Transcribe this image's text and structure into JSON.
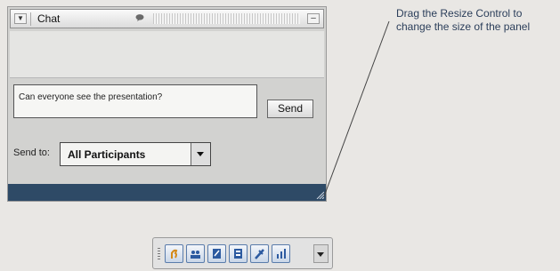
{
  "panel": {
    "title": "Chat",
    "message_text": "Can everyone see the presentation?",
    "send_label": "Send",
    "send_to_label": "Send to:",
    "send_to_value": "All Participants"
  },
  "callout": {
    "line1": "Drag the Resize Control to",
    "line2": "change the size of the panel"
  },
  "colors": {
    "status_bar": "#2e4a66",
    "callout_text": "#2b3e5a",
    "toolbar_button": "#5a7cab"
  },
  "toolbar_icons": [
    "raise-hand-icon",
    "participants-icon",
    "notes-icon",
    "captions-icon",
    "annotate-icon",
    "poll-icon"
  ]
}
